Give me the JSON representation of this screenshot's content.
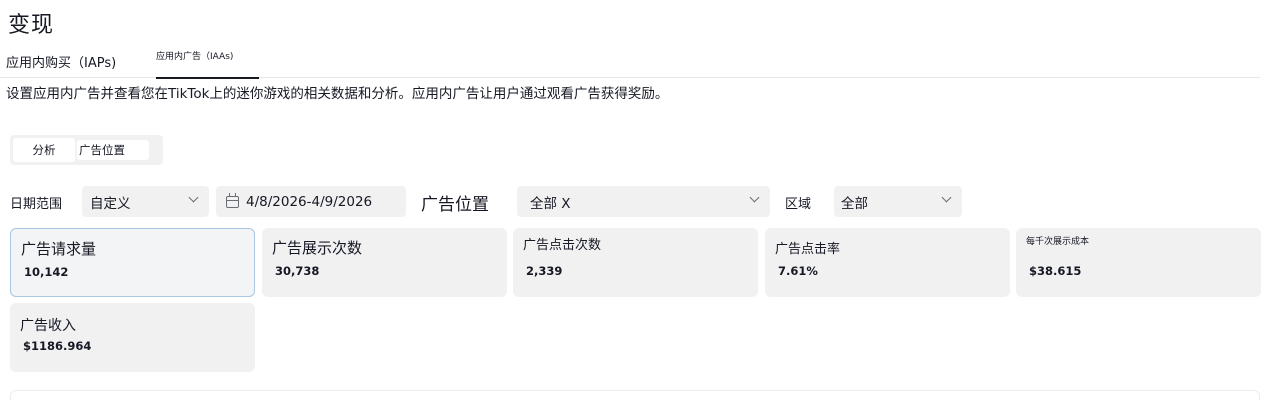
{
  "page": {
    "title": "变现",
    "description": "设置应用内广告并查看您在TikTok上的迷你游戏的相关数据和分析。应用内广告让用户通过观看广告获得奖励。"
  },
  "tabs": [
    {
      "label": "应用内购买（IAPs)",
      "active": false
    },
    {
      "label": "应用内广告（IAAs)",
      "active": true
    }
  ],
  "segmented": {
    "analysis_label": "分析",
    "placement_label": "广告位置",
    "selected": "分析"
  },
  "filters": {
    "date_label": "日期范围",
    "date_mode": "自定义",
    "date_range": "4/8/2026-4/9/2026",
    "placement_label": "广告位置",
    "placement_value": "全部 X",
    "region_label": "区域",
    "region_value": "全部"
  },
  "metrics": [
    {
      "label": "广告请求量",
      "value": "10,142",
      "selected": true
    },
    {
      "label": "广告展示次数",
      "value": "30,738"
    },
    {
      "label": "广告点击次数",
      "value": "2,339"
    },
    {
      "label": "广告点击率",
      "value": "7.61%"
    },
    {
      "label": "每千次展示成本",
      "value": "$38.615"
    },
    {
      "label": "广告收入",
      "value": "$1186.964"
    }
  ],
  "icons": {
    "calendar": "calendar-icon",
    "dropdown": "chevron-down-icon"
  },
  "colors": {
    "text": "#161823",
    "card_bg": "#f1f1f2",
    "selected_border": "#a9c6e3",
    "divider": "#e6e6e8"
  }
}
